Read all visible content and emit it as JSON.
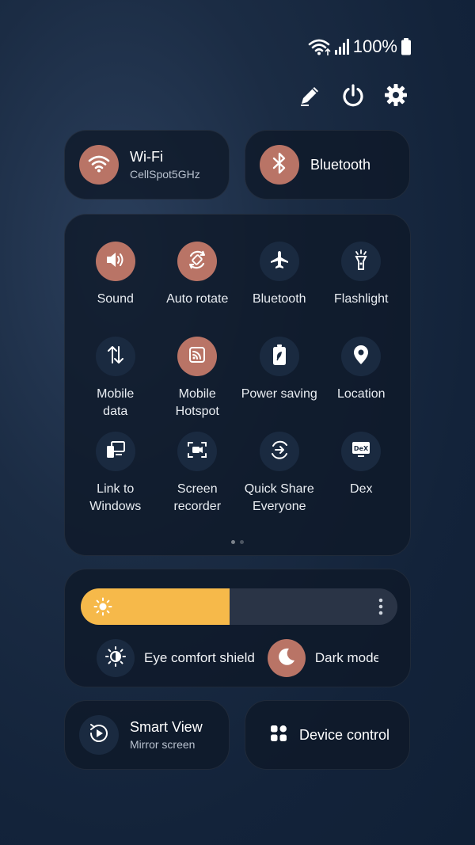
{
  "status": {
    "battery_text": "100%"
  },
  "top_actions": {
    "icons": [
      "pencil-icon",
      "power-icon",
      "gear-icon"
    ]
  },
  "wifi_tile": {
    "title": "Wi-Fi",
    "subtitle": "CellSpot5GHz",
    "active": true
  },
  "bluetooth_tile": {
    "title": "Bluetooth",
    "active": true
  },
  "quick_settings": {
    "rows": [
      [
        {
          "label": "Sound",
          "icon": "speaker-icon",
          "active": true
        },
        {
          "label": "Auto rotate",
          "icon": "rotate-icon",
          "active": true
        },
        {
          "label": "Bluetooth",
          "icon": "airplane-icon",
          "active": false
        },
        {
          "label": "Flashlight",
          "icon": "flashlight-icon",
          "active": false
        }
      ],
      [
        {
          "label": "Mobile\ndata",
          "icon": "mobile-data-icon",
          "active": false
        },
        {
          "label": "Mobile\nHotspot",
          "icon": "hotspot-icon",
          "active": true
        },
        {
          "label": "Power saving",
          "icon": "power-saving-icon",
          "active": false
        },
        {
          "label": "Location",
          "icon": "location-pin-icon",
          "active": false
        }
      ],
      [
        {
          "label": "Link to\nWindows",
          "icon": "link-windows-icon",
          "active": false
        },
        {
          "label": "Screen\nrecorder",
          "icon": "screen-recorder-icon",
          "active": false
        },
        {
          "label": "Quick Share\nEveryone",
          "icon": "quick-share-icon",
          "active": false
        },
        {
          "label": "Dex",
          "icon": "dex-icon",
          "active": false
        }
      ]
    ],
    "page_indicator": {
      "pages": 2,
      "current": 1
    }
  },
  "brightness": {
    "level": 0.47,
    "fill_color": "#f6b94a",
    "eye_comfort_label": "Eye comfort shield",
    "dark_mode_label": "Dark mode",
    "dark_mode_active": true
  },
  "smart_view": {
    "title": "Smart View",
    "subtitle": "Mirror screen"
  },
  "device_control": {
    "title": "Device control"
  },
  "colors": {
    "accent_on": "#b97466",
    "tile_off": "#1a2a40",
    "panel": "#0e1828"
  }
}
